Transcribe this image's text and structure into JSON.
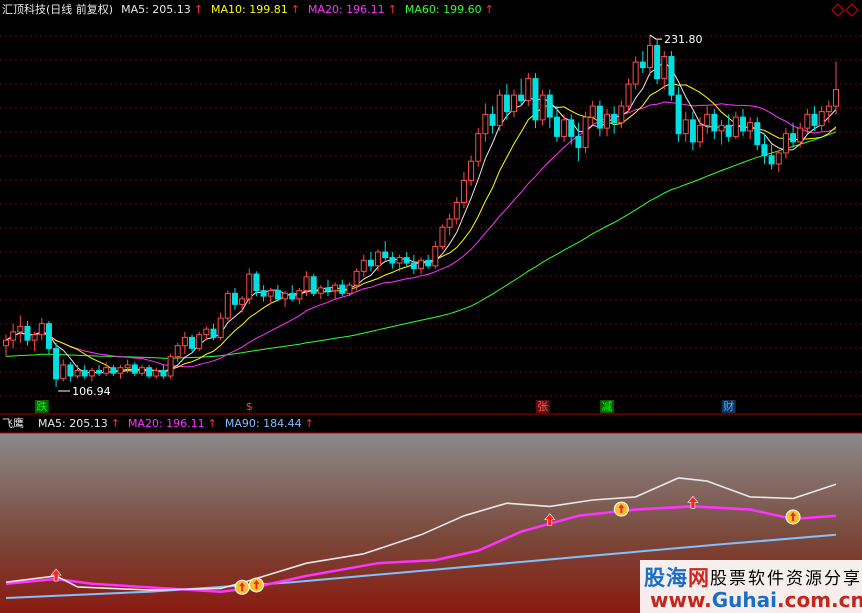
{
  "main_header": {
    "title": "汇顶科技(日线 前复权)",
    "items": [
      {
        "label": "MA5: 205.13",
        "color": "#e8e8e8",
        "arrow": "↑"
      },
      {
        "label": "MA10: 199.81",
        "color": "#ffff00",
        "arrow": "↑"
      },
      {
        "label": "MA20: 196.11",
        "color": "#ff33ff",
        "arrow": "↑"
      },
      {
        "label": "MA60: 199.60",
        "color": "#33ff33",
        "arrow": "↑"
      }
    ],
    "diamond_icon": "diamond-outline-icon"
  },
  "price_labels": {
    "high": "231.80",
    "low": "106.94"
  },
  "event_markers": [
    {
      "label": "跌",
      "color": "#00ff00",
      "bg": "#0a5a0a",
      "bar": 5
    },
    {
      "label": "$",
      "color": "#ff4040",
      "bg": "",
      "bar": 34
    },
    {
      "label": "张",
      "color": "#ff6060",
      "bg": "#5a1010",
      "bar": 75
    },
    {
      "label": "减",
      "color": "#00ff00",
      "bg": "#0a5a0a",
      "bar": 84
    },
    {
      "label": "财",
      "color": "#40b0ff",
      "bg": "#10305a",
      "bar": 101
    }
  ],
  "indicator_header": {
    "title": "飞鹰",
    "items": [
      {
        "label": "MA5: 205.13",
        "color": "#e8e8e8",
        "arrow": "↑"
      },
      {
        "label": "MA20: 196.11",
        "color": "#ff33ff",
        "arrow": "↑"
      },
      {
        "label": "MA90: 184.44",
        "color": "#80c0ff",
        "arrow": "↑"
      }
    ]
  },
  "colors": {
    "up": "#ff4c4c",
    "down": "#00e0e0",
    "ma5": "#e8e8e8",
    "ma10": "#ffff00",
    "ma20": "#ff33ff",
    "ma60": "#33ff33",
    "ma90": "#80c0ff",
    "grid": "#7a0000"
  },
  "chart_data": {
    "type": "candlestick",
    "bars": 117,
    "y_range_main": [
      100,
      238
    ],
    "candles": [
      [
        119,
        123,
        115,
        121
      ],
      [
        121,
        127,
        118,
        124
      ],
      [
        124,
        130,
        120,
        126
      ],
      [
        126,
        128,
        119,
        121
      ],
      [
        121,
        124,
        117,
        123
      ],
      [
        123,
        129,
        121,
        127
      ],
      [
        127,
        128,
        116,
        118
      ],
      [
        118,
        120,
        104,
        106.94
      ],
      [
        107,
        114,
        106,
        112
      ],
      [
        112,
        113,
        106,
        108
      ],
      [
        108,
        112,
        107,
        110
      ],
      [
        110,
        112,
        107,
        108
      ],
      [
        108,
        111,
        106,
        110
      ],
      [
        110,
        112,
        108,
        109
      ],
      [
        109,
        113,
        108,
        111
      ],
      [
        111,
        112,
        108,
        109
      ],
      [
        109,
        112,
        107,
        111
      ],
      [
        111,
        114,
        109,
        112
      ],
      [
        112,
        113,
        108,
        109
      ],
      [
        109,
        112,
        108,
        111
      ],
      [
        111,
        112,
        107,
        108
      ],
      [
        108,
        111,
        107,
        110
      ],
      [
        110,
        112,
        107,
        108
      ],
      [
        108,
        116,
        107,
        115
      ],
      [
        115,
        120,
        113,
        119
      ],
      [
        119,
        124,
        116,
        122
      ],
      [
        122,
        123,
        117,
        118
      ],
      [
        118,
        124,
        117,
        123
      ],
      [
        123,
        126,
        121,
        125
      ],
      [
        125,
        127,
        121,
        122
      ],
      [
        122,
        131,
        121,
        129
      ],
      [
        129,
        139,
        128,
        138
      ],
      [
        138,
        140,
        132,
        134
      ],
      [
        134,
        137,
        131,
        136
      ],
      [
        136,
        147,
        134,
        145
      ],
      [
        145,
        146,
        137,
        139
      ],
      [
        139,
        141,
        135,
        137
      ],
      [
        137,
        140,
        134,
        139
      ],
      [
        139,
        141,
        135,
        136
      ],
      [
        136,
        139,
        133,
        138
      ],
      [
        138,
        141,
        135,
        136
      ],
      [
        136,
        140,
        134,
        139
      ],
      [
        139,
        146,
        137,
        144
      ],
      [
        144,
        145,
        137,
        138
      ],
      [
        138,
        141,
        136,
        140
      ],
      [
        140,
        143,
        137,
        139
      ],
      [
        139,
        142,
        136,
        141
      ],
      [
        141,
        143,
        137,
        138
      ],
      [
        138,
        142,
        137,
        141
      ],
      [
        141,
        147,
        139,
        146
      ],
      [
        146,
        152,
        144,
        150
      ],
      [
        150,
        153,
        146,
        148
      ],
      [
        148,
        154,
        146,
        153
      ],
      [
        153,
        157,
        150,
        151
      ],
      [
        151,
        153,
        147,
        149
      ],
      [
        149,
        152,
        146,
        151
      ],
      [
        151,
        153,
        148,
        149
      ],
      [
        149,
        152,
        145,
        147
      ],
      [
        147,
        151,
        145,
        150
      ],
      [
        150,
        152,
        147,
        148
      ],
      [
        148,
        157,
        147,
        155
      ],
      [
        155,
        163,
        154,
        162
      ],
      [
        162,
        167,
        159,
        165
      ],
      [
        165,
        173,
        163,
        171
      ],
      [
        171,
        182,
        169,
        179
      ],
      [
        179,
        188,
        177,
        186
      ],
      [
        186,
        198,
        184,
        196
      ],
      [
        196,
        207,
        193,
        203
      ],
      [
        203,
        206,
        196,
        199
      ],
      [
        199,
        212,
        197,
        210
      ],
      [
        210,
        214,
        201,
        204
      ],
      [
        204,
        212,
        202,
        210
      ],
      [
        210,
        216,
        206,
        208
      ],
      [
        208,
        218,
        206,
        216
      ],
      [
        216,
        218,
        198,
        201
      ],
      [
        201,
        212,
        199,
        210
      ],
      [
        210,
        212,
        198,
        202
      ],
      [
        202,
        206,
        193,
        195
      ],
      [
        195,
        203,
        193,
        201
      ],
      [
        201,
        203,
        192,
        195
      ],
      [
        195,
        200,
        186,
        191
      ],
      [
        191,
        204,
        189,
        202
      ],
      [
        202,
        208,
        199,
        206
      ],
      [
        206,
        208,
        195,
        198
      ],
      [
        198,
        205,
        195,
        203
      ],
      [
        203,
        206,
        196,
        200
      ],
      [
        200,
        208,
        198,
        206
      ],
      [
        206,
        216,
        204,
        214
      ],
      [
        214,
        224,
        212,
        222
      ],
      [
        222,
        226,
        218,
        220
      ],
      [
        220,
        231.8,
        217,
        228
      ],
      [
        228,
        230,
        214,
        216
      ],
      [
        216,
        226,
        212,
        224
      ],
      [
        224,
        226,
        208,
        210
      ],
      [
        210,
        213,
        193,
        196
      ],
      [
        196,
        204,
        193,
        201
      ],
      [
        201,
        204,
        190,
        193
      ],
      [
        193,
        202,
        191,
        199
      ],
      [
        199,
        206,
        196,
        203
      ],
      [
        203,
        205,
        194,
        197
      ],
      [
        197,
        201,
        192,
        199
      ],
      [
        199,
        203,
        193,
        195
      ],
      [
        195,
        204,
        194,
        202
      ],
      [
        202,
        205,
        195,
        197
      ],
      [
        197,
        202,
        194,
        200
      ],
      [
        200,
        202,
        190,
        192
      ],
      [
        192,
        196,
        185,
        188
      ],
      [
        188,
        192,
        183,
        185
      ],
      [
        185,
        190,
        182,
        189
      ],
      [
        189,
        198,
        187,
        196
      ],
      [
        196,
        200,
        191,
        193
      ],
      [
        193,
        200,
        191,
        198
      ],
      [
        198,
        205,
        196,
        203
      ],
      [
        203,
        206,
        197,
        199
      ],
      [
        199,
        206,
        197,
        204
      ],
      [
        204,
        208,
        200,
        206
      ],
      [
        206,
        222,
        203,
        212
      ]
    ],
    "indicator_y_range": [
      0,
      100
    ],
    "indicator": {
      "ma5_line": [
        [
          0,
          10
        ],
        [
          7,
          14
        ],
        [
          10,
          7
        ],
        [
          20,
          5
        ],
        [
          30,
          6
        ],
        [
          34,
          11
        ],
        [
          42,
          22
        ],
        [
          50,
          28
        ],
        [
          58,
          40
        ],
        [
          64,
          52
        ],
        [
          70,
          60
        ],
        [
          76,
          58
        ],
        [
          82,
          62
        ],
        [
          88,
          64
        ],
        [
          94,
          76
        ],
        [
          98,
          74
        ],
        [
          104,
          64
        ],
        [
          110,
          63
        ],
        [
          116,
          72
        ]
      ],
      "ma20_line": [
        [
          0,
          9
        ],
        [
          7,
          12
        ],
        [
          12,
          9
        ],
        [
          30,
          4
        ],
        [
          34,
          6
        ],
        [
          42,
          14
        ],
        [
          52,
          22
        ],
        [
          60,
          24
        ],
        [
          66,
          30
        ],
        [
          72,
          42
        ],
        [
          80,
          52
        ],
        [
          88,
          56
        ],
        [
          96,
          58
        ],
        [
          104,
          56
        ],
        [
          110,
          50
        ],
        [
          116,
          52
        ]
      ],
      "ma90_line": [
        [
          0,
          0
        ],
        [
          20,
          4
        ],
        [
          40,
          10
        ],
        [
          60,
          18
        ],
        [
          80,
          26
        ],
        [
          100,
          34
        ],
        [
          116,
          40
        ]
      ],
      "signal_markers": [
        {
          "bar": 7,
          "type": "up-arrow"
        },
        {
          "bar": 33,
          "type": "money-bag"
        },
        {
          "bar": 35,
          "type": "money-bag"
        },
        {
          "bar": 76,
          "type": "up-arrow"
        },
        {
          "bar": 86,
          "type": "money-bag"
        },
        {
          "bar": 96,
          "type": "up-arrow"
        },
        {
          "bar": 110,
          "type": "money-bag"
        }
      ]
    }
  },
  "watermark": {
    "brand_a": "股海",
    "brand_b": "网",
    "tagline": "股票软件资源分享",
    "url_a": "www.",
    "url_b": "Guhai",
    "url_c": ".com.cn"
  }
}
